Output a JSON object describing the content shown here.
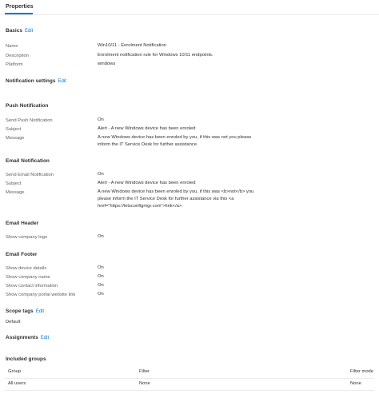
{
  "tab": {
    "label": "Properties"
  },
  "basics": {
    "title": "Basics",
    "edit": "Edit",
    "rows": [
      {
        "label": "Name",
        "value": "Win10/11 - Enrolment Notification"
      },
      {
        "label": "Description",
        "value": "Enrolment notification rule for Windows 10/11 endpoints."
      },
      {
        "label": "Platform",
        "value": "windows"
      }
    ]
  },
  "notification_settings": {
    "title": "Notification settings",
    "edit": "Edit"
  },
  "push_notification": {
    "title": "Push Notification",
    "rows": [
      {
        "label": "Send Push Notification",
        "value": "On"
      },
      {
        "label": "Subject",
        "value": "Alert - A new Windows device has been enroled"
      },
      {
        "label": "Message",
        "lines": [
          "A new Windows device has been enroled by you, if this was not you please",
          "inform the IT Service Desk for further assistance."
        ]
      }
    ]
  },
  "email_notification": {
    "title": "Email Notification",
    "rows": [
      {
        "label": "Send Email Notification",
        "value": "On"
      },
      {
        "label": "Subject",
        "value": "Alert - A new Windows device has been enroled"
      },
      {
        "label": "Message",
        "lines": [
          "A new Windows device has been enroled by you, if this was <b>not</b> you",
          "please inform the IT Service Desk for further assistance via this <a",
          "href=\"https://letsconfigmgr.com\">link</a>."
        ]
      }
    ]
  },
  "email_header": {
    "title": "Email Header",
    "rows": [
      {
        "label": "Show company logo",
        "value": "On"
      }
    ]
  },
  "email_footer": {
    "title": "Email Footer",
    "rows": [
      {
        "label": "Show device details",
        "value": "On"
      },
      {
        "label": "Show company name",
        "value": "On"
      },
      {
        "label": "Show contact information",
        "value": "On"
      },
      {
        "label": "Show company portal website link",
        "value": "On"
      }
    ]
  },
  "scope_tags": {
    "title": "Scope tags",
    "edit": "Edit",
    "value": "Default"
  },
  "assignments": {
    "title": "Assignments",
    "edit": "Edit"
  },
  "included_groups": {
    "title": "Included groups",
    "columns": [
      "Group",
      "Filter",
      "Filter mode"
    ],
    "rows": [
      [
        "All users",
        "None",
        "None"
      ]
    ]
  },
  "colors": {
    "accent": "#0078d4",
    "text": "#323130",
    "label": "#605e5c",
    "divider": "#edebe9"
  }
}
